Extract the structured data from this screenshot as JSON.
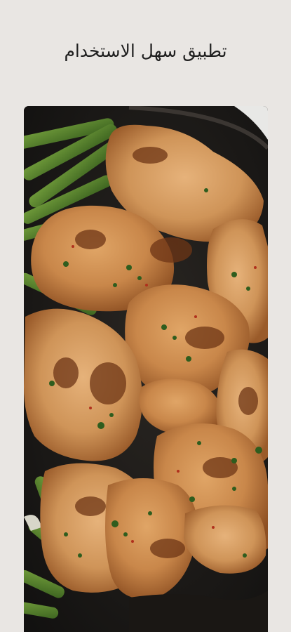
{
  "screen": {
    "headline": "تطبيق سهل الاستخدام"
  },
  "photo": {
    "subject": "food-photo",
    "colors": {
      "background": "#e9e6e3",
      "pan": "#1c1a18",
      "chicken": "#c98a4f",
      "sear": "#7a3f1c",
      "beans": "#4f7a2c",
      "herbs": "#2f5d1e"
    }
  }
}
